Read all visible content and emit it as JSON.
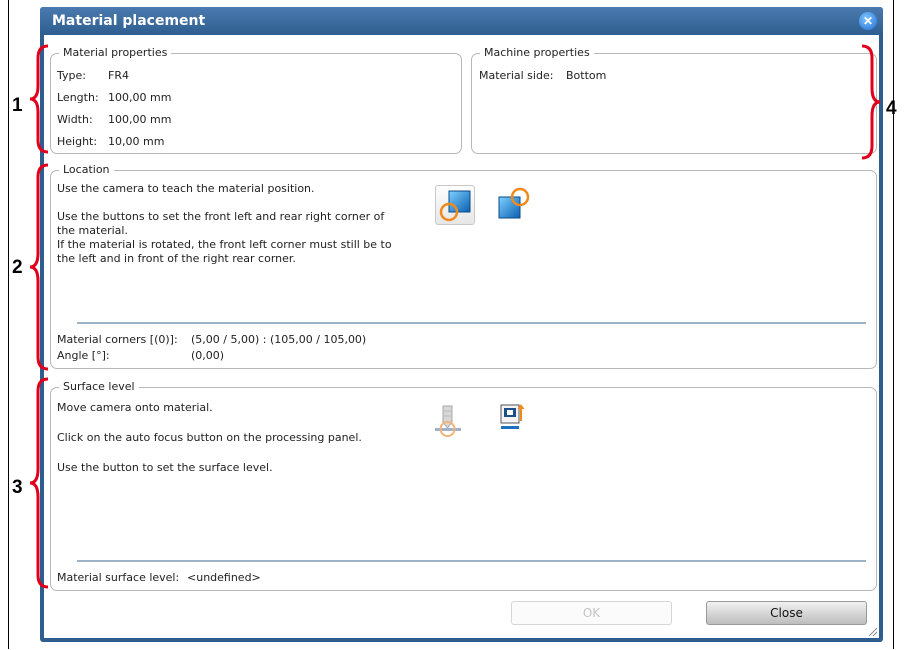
{
  "dialog": {
    "title": "Material placement"
  },
  "material_properties": {
    "legend": "Material properties",
    "rows": [
      {
        "label": "Type:",
        "value": "FR4"
      },
      {
        "label": "Length:",
        "value": "100,00 mm"
      },
      {
        "label": "Width:",
        "value": "100,00 mm"
      },
      {
        "label": "Height:",
        "value": "10,00 mm"
      }
    ]
  },
  "machine_properties": {
    "legend": "Machine properties",
    "side_label": "Material side:",
    "side_value": "Bottom"
  },
  "location": {
    "legend": "Location",
    "line1": "Use the camera to teach the material position.",
    "line2": "Use the buttons to set the front left and rear right corner of",
    "line3": "the material.",
    "line4": "If the material is rotated, the front left corner must still be to",
    "line5": "the left and in front of the right rear corner.",
    "corners_label": "Material corners [(0)]:",
    "corners_value": "(5,00 / 5,00) : (105,00 / 105,00)",
    "angle_label": "Angle [°]:",
    "angle_value": "(0,00)"
  },
  "surface": {
    "legend": "Surface level",
    "line1": "Move camera onto material.",
    "line2": "Click on the auto focus button on the processing panel.",
    "line3": "Use the button to set the surface level.",
    "level_label": "Material surface level:",
    "level_value": "<undefined>"
  },
  "buttons": {
    "ok": "OK",
    "close": "Close"
  },
  "callouts": {
    "c1": "1",
    "c2": "2",
    "c3": "3",
    "c4": "4"
  },
  "icons": {
    "close": "close-icon",
    "front_left": "front-left-corner-icon",
    "rear_right": "rear-right-corner-icon",
    "autofocus": "autofocus-camera-icon",
    "surface": "set-surface-level-icon"
  },
  "colors": {
    "titlebar": "#2f5d8f",
    "callout_brace": "#e0001b",
    "separator": "#9fb3c8"
  }
}
